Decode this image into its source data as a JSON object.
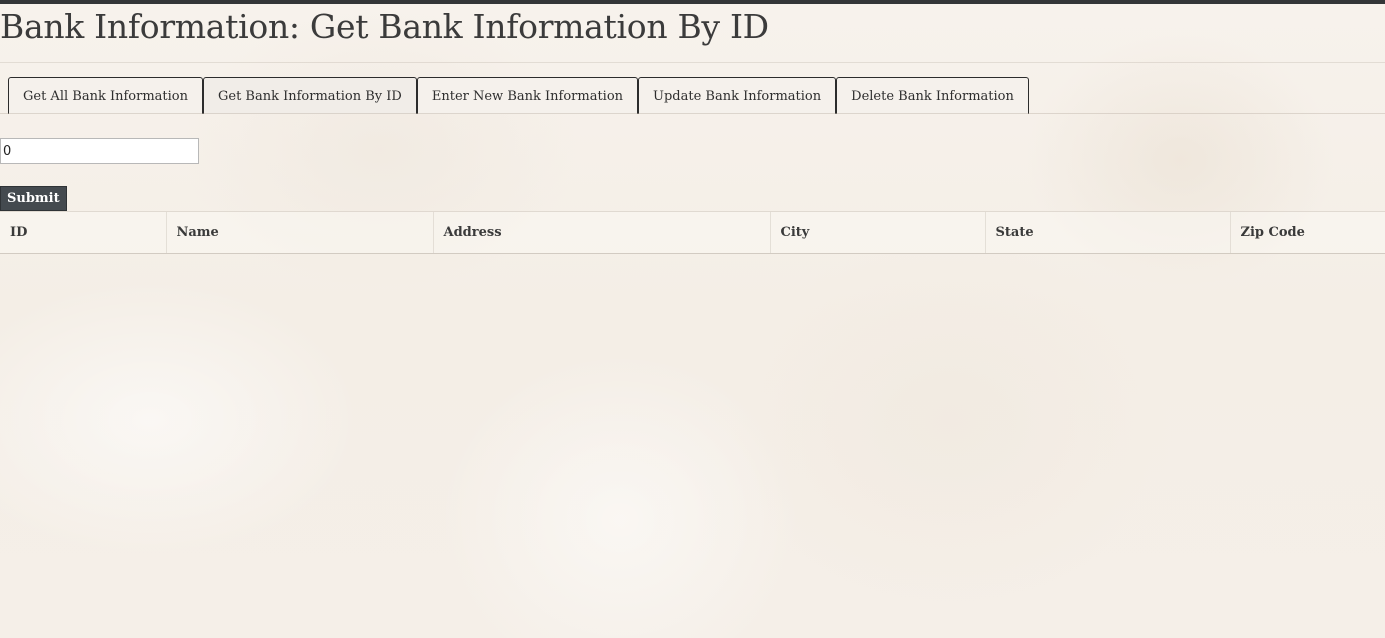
{
  "page": {
    "title": "Bank Information: Get Bank Information By ID"
  },
  "tabs": [
    {
      "label": "Get All Bank Information",
      "active": false
    },
    {
      "label": "Get Bank Information By ID",
      "active": true
    },
    {
      "label": "Enter New Bank Information",
      "active": false
    },
    {
      "label": "Update Bank Information",
      "active": false
    },
    {
      "label": "Delete Bank Information",
      "active": false
    }
  ],
  "form": {
    "id_value": "0",
    "submit_label": "Submit"
  },
  "table": {
    "columns": [
      "ID",
      "Name",
      "Address",
      "City",
      "State",
      "Zip Code"
    ],
    "rows": []
  },
  "colors": {
    "topbar": "#333638",
    "button_bg": "#444a4f",
    "button_text": "#ffffff",
    "tab_border": "#2c2c2c"
  }
}
